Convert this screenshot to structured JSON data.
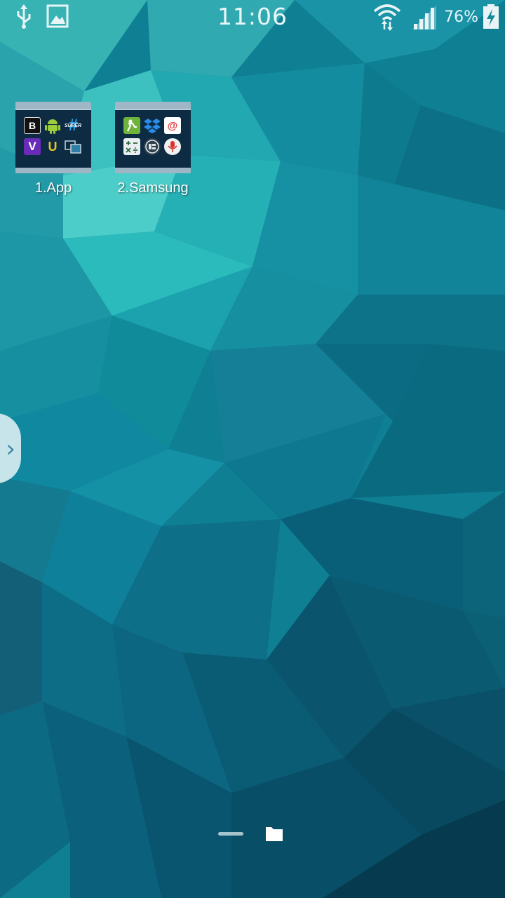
{
  "status_bar": {
    "time": "11:06",
    "battery_percent": "76%",
    "left_icons": [
      "usb-icon",
      "gallery-icon"
    ],
    "right_icons": [
      "wifi-icon",
      "signal-icon",
      "battery-charging-icon"
    ]
  },
  "folders": [
    {
      "label": "1.App",
      "apps": [
        {
          "icon": "b-app-icon",
          "glyph": "B"
        },
        {
          "icon": "android-icon",
          "glyph": ""
        },
        {
          "icon": "supersu-icon",
          "glyph": "SUPER"
        },
        {
          "icon": "viber-icon",
          "glyph": "V"
        },
        {
          "icon": "u-app-icon",
          "glyph": "U"
        },
        {
          "icon": "screen-app-icon",
          "glyph": ""
        }
      ]
    },
    {
      "label": "2.Samsung",
      "apps": [
        {
          "icon": "s-health-icon",
          "glyph": ""
        },
        {
          "icon": "dropbox-icon",
          "glyph": ""
        },
        {
          "icon": "email-icon",
          "glyph": "@"
        },
        {
          "icon": "calculator-icon",
          "glyph": ""
        },
        {
          "icon": "memo-icon",
          "glyph": ""
        },
        {
          "icon": "voice-recorder-icon",
          "glyph": ""
        }
      ]
    }
  ],
  "edge_handle": {
    "glyph": "›"
  },
  "page_indicator": {
    "pages": [
      "dash",
      "folder"
    ],
    "current": "folder"
  },
  "colors": {
    "wallpaper_base": "#0f7f93",
    "folder_body": "#0d2c44",
    "folder_tab": "#9fb6c6"
  }
}
